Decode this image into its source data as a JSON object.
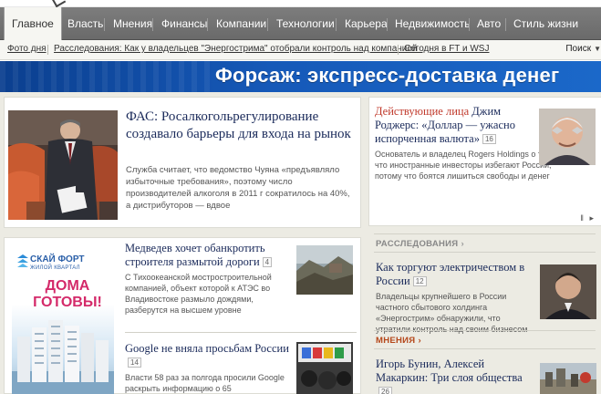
{
  "nav": {
    "items": [
      {
        "label": "Главное",
        "active": true
      },
      {
        "label": "Власть"
      },
      {
        "label": "Мнения"
      },
      {
        "label": "Финансы"
      },
      {
        "label": "Компании"
      },
      {
        "label": "Технологии"
      },
      {
        "label": "Карьера"
      },
      {
        "label": "Недвижимость"
      },
      {
        "label": "Авто"
      },
      {
        "label": "Стиль жизни"
      }
    ]
  },
  "subnav": {
    "links": [
      {
        "label": "Фото дня"
      },
      {
        "label": "Расследования: Как у владельцев \"Энергострима\" отобрали контроль над компанией"
      },
      {
        "label": "Сегодня в FT и WSJ"
      }
    ],
    "search_label": "Поиск"
  },
  "banner": {
    "text": "Форсаж: экспресс-доставка денег",
    "color": "#1659b8"
  },
  "lead": {
    "title": "ФАС: Росалкогольрегулирование создавало барьеры для входа на рынок",
    "description": "Служба считает, что ведомство Чуяна «предъявляло избыточные требования», поэтому число производителей алкоголя в 2011 г сократилось на 40%, а дистрибуторов — вдвое"
  },
  "ad": {
    "brand": "СКАЙ ФОРТ",
    "brand_sub": "ЖИЛОЙ КВАРТАЛ",
    "headline": "ДОМА ГОТОВЫ!",
    "headline_color": "#d42a6a"
  },
  "stories": [
    {
      "title": "Медведев хочет обанкротить строителя размытой дороги",
      "count": "4",
      "description": "С Тихоокеанской мостростроительной компанией, объект которой к АТЭС во Владивостоке размыло дождями, разберутся на высшем уровне"
    },
    {
      "title": "Google не вняла просьбам России",
      "count": "14",
      "description": "Власти 58 раз за полгода просили Google раскрыть информацию о 65"
    }
  ],
  "right": {
    "featured": {
      "title_prefix": "Действующие лица",
      "title_rest": " Джим Роджерс: «Доллар — ужасно испорченная валюта»",
      "count": "16",
      "description": "Основатель и владелец Rogers Holdings о том, что иностранные инвесторы избегают России, потому что боятся лишиться свободы и денег"
    },
    "pager": "‖ ▸",
    "sections": [
      {
        "label": "РАССЛЕДОВАНИЯ",
        "title": "Как торгуют электричеством в России",
        "count": "12",
        "description": "Владельцы крупнейшего в России частного сбытового холдинга «Энергострим» обнаружили, что утратили контроль над своим бизнесом"
      },
      {
        "label": "МНЕНИЯ",
        "title": "Игорь Бунин, Алексей Макаркин: Три слоя общества",
        "count": "26"
      }
    ]
  }
}
